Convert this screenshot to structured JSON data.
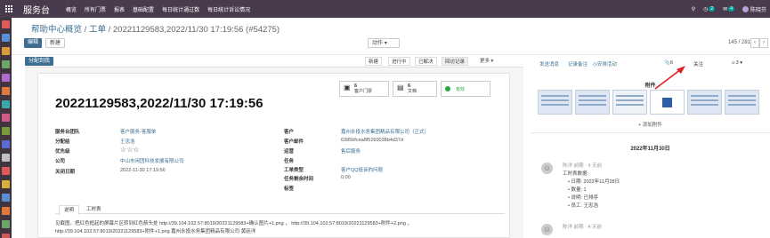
{
  "topbar": {
    "brand": "服务台",
    "menu": [
      "概览",
      "所有门票",
      "报表",
      "基础配置",
      "每日统计通过数",
      "每日统计诉讼情况"
    ],
    "chat_count": "4",
    "activity_count": "2",
    "user": "陈晓芬"
  },
  "colors": {
    "topbar": "#4a3a4e",
    "primary": "#3d6e92",
    "sidebar": "#40343f"
  },
  "breadcrumb": {
    "part1": "帮助中心概览",
    "sep": "/",
    "part2": "工单",
    "sep2": "/",
    "record": "20221129583,2022/11/30 17:19:56 (#54275)"
  },
  "controls": {
    "edit": "编辑",
    "create": "新建",
    "action": "动作",
    "pager": "145 / 281"
  },
  "statusbar": {
    "assign": "分配到我",
    "stages": [
      "新建",
      "进行中",
      "已解决",
      "回访记录",
      "更多"
    ]
  },
  "smart_buttons": {
    "tickets_count": "6",
    "tickets_label": "客户门票",
    "docs_count": "6",
    "docs_label": "文档",
    "active_label": "有效"
  },
  "ticket": {
    "title": "20221129583,2022/11/30 17:19:56",
    "left": [
      [
        "服务台团队",
        "客户服务-客服单"
      ],
      [
        "分配给",
        "王忠浩"
      ],
      [
        "优先级",
        "☆☆☆"
      ],
      [
        "公司",
        "中山市闲团科技发展有限公司"
      ],
      [
        "关闭日期",
        "2022-11-30 17:19:56"
      ]
    ],
    "right": [
      [
        "客户",
        "嘉州永投水务集团精品有限公司（正式）"
      ],
      [
        "客户邮件",
        "6385bfcea8f5260038b4d37d"
      ],
      [
        "运营",
        "售后服务"
      ],
      [
        "任务",
        ""
      ],
      [
        "工单类型",
        "客户QQ投诉的问题"
      ],
      [
        "任务剩余时间",
        "0:00"
      ],
      [
        "标签",
        ""
      ]
    ]
  },
  "tabs": {
    "description": "说明",
    "timesheet": "工时表"
  },
  "note": {
    "line1": "见截图，把红色框起的屏幕片区转到红色箭头处  http://39.104.102.57:8019/20221129583+确认图片+1.png ，  http://39.104.102.57:8019/20221129583+附件+2.png ，",
    "line2": "http://39.104.102.57:8019/20221129583+附件+1.png  嘉州永投水务集团精品有限公司  黄廷洋"
  },
  "chatter": {
    "send": "发送消息",
    "log": "记录备注",
    "schedule": "安排活动",
    "attach_count": "6",
    "follow": "关注",
    "followers": "3",
    "attachments_label": "附件",
    "add_attachment": "添加附件",
    "day": "2022年11月30日"
  },
  "messages": [
    {
      "author": "陈洋 前期 · 4 天前",
      "lines": [
        "工时表数据:",
        "• 日期: 2022年11月28日",
        "• 数量: 1",
        "• 说明: 已排序",
        "• 员工: 王忠浩"
      ]
    },
    {
      "author": "陈洋 前期 · 4 天前",
      "lines": []
    }
  ]
}
